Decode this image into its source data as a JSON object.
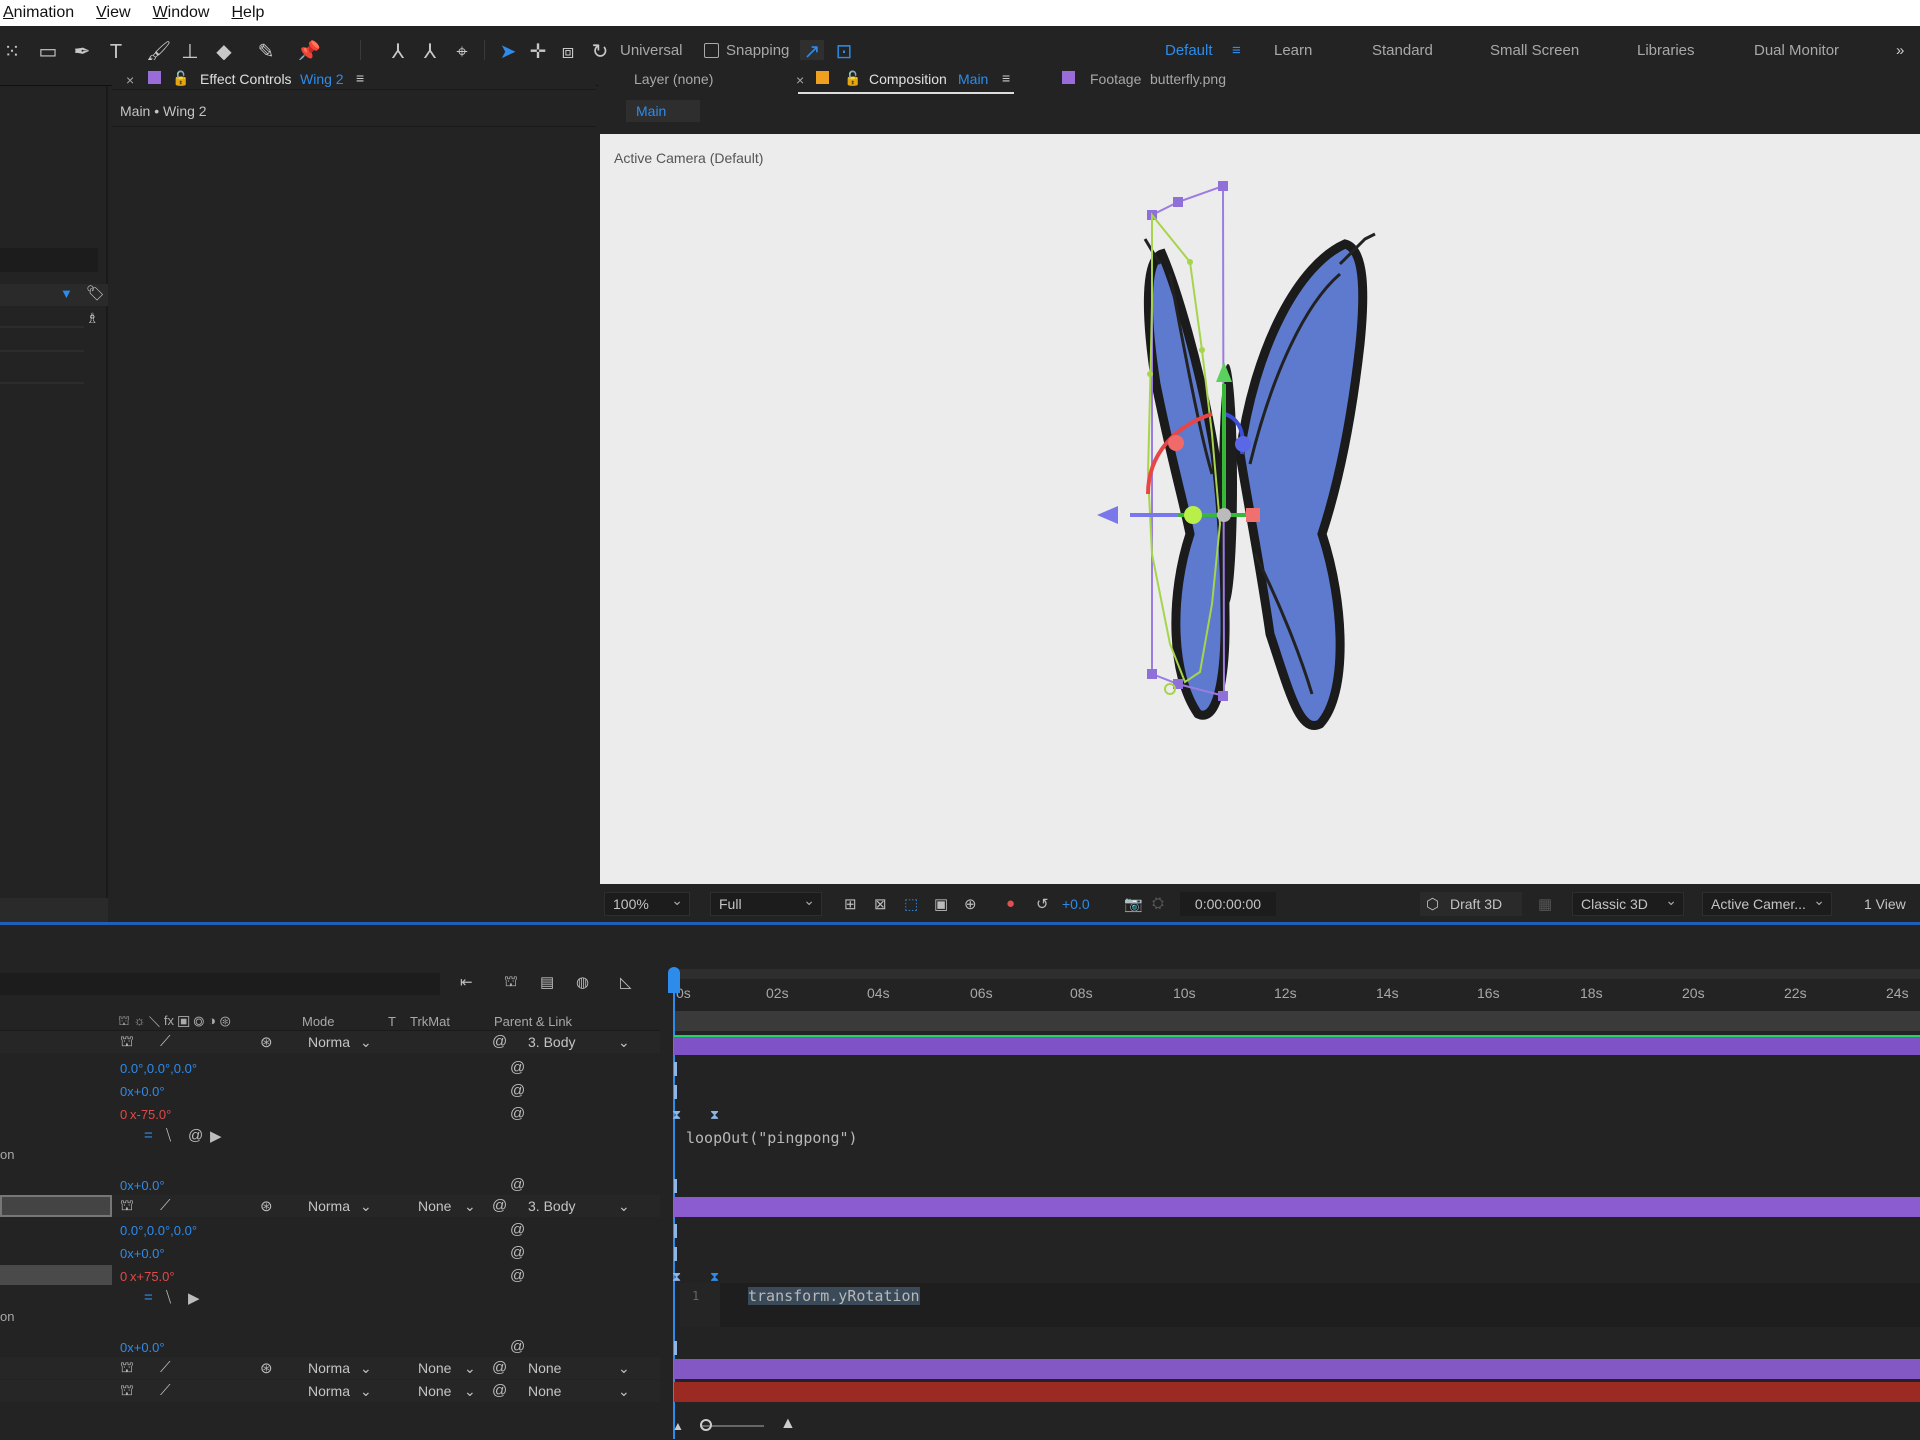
{
  "menu": [
    "Animation",
    "View",
    "Window",
    "Help"
  ],
  "toolbar": {
    "universal_label": "Universal",
    "snapping_label": "Snapping"
  },
  "workspaces": [
    "Default",
    "Learn",
    "Standard",
    "Small Screen",
    "Libraries",
    "Dual Monitor"
  ],
  "effect_controls": {
    "tab_label": "Effect Controls",
    "layer_name": "Wing 2",
    "breadcrumb": "Main • Wing 2"
  },
  "composition_tabs": {
    "layer_tab": "Layer (none)",
    "comp_tab": "Composition",
    "comp_name": "Main",
    "footage_tab": "Footage",
    "footage_name": "butterfly.png",
    "sub_tab": "Main"
  },
  "viewer": {
    "camera_label": "Active Camera (Default)"
  },
  "viewer_bar": {
    "zoom": "100%",
    "resolution": "Full",
    "exposure": "+0.0",
    "timecode": "0:00:00:00",
    "draft": "Draft 3D",
    "renderer": "Classic 3D",
    "camera": "Active Camer...",
    "views": "1 View"
  },
  "timeline": {
    "columns": {
      "mode": "Mode",
      "t": "T",
      "trkmat": "TrkMat",
      "parent": "Parent & Link"
    },
    "ruler": [
      "0s",
      "02s",
      "04s",
      "06s",
      "08s",
      "10s",
      "12s",
      "14s",
      "16s",
      "18s",
      "20s",
      "22s",
      "24s"
    ],
    "rows": {
      "r1_mode": "Norma",
      "r1_parent": "3. Body",
      "r1_v1": "0.0°,0.0°,0.0°",
      "r1_v2": "0x+0.0°",
      "r1_v3a": "0",
      "r1_v3b": "x-75.0°",
      "expr1": "loopOut(\"pingpong\")",
      "on1": "on",
      "r1_v4": "0x+0.0°",
      "r2_mode": "Norma",
      "r2_trk": "None",
      "r2_parent": "3. Body",
      "r2_v1": "0.0°,0.0°,0.0°",
      "r2_v2": "0x+0.0°",
      "r2_v3a": "0",
      "r2_v3b": "x+75.0°",
      "expr2_line": "1",
      "expr2": "transform.yRotation",
      "on2": "on",
      "r2_v4": "0x+0.0°",
      "r3_mode": "Norma",
      "r3_trk": "None",
      "r3_parent": "None",
      "r4_mode": "Norma",
      "r4_trk": "None",
      "r4_parent": "None"
    }
  },
  "colors": {
    "accent": "#2d8ceb",
    "purple_bar": "#8b5ccf",
    "red_bar": "#9a2a22",
    "green_line": "#1ed760"
  }
}
